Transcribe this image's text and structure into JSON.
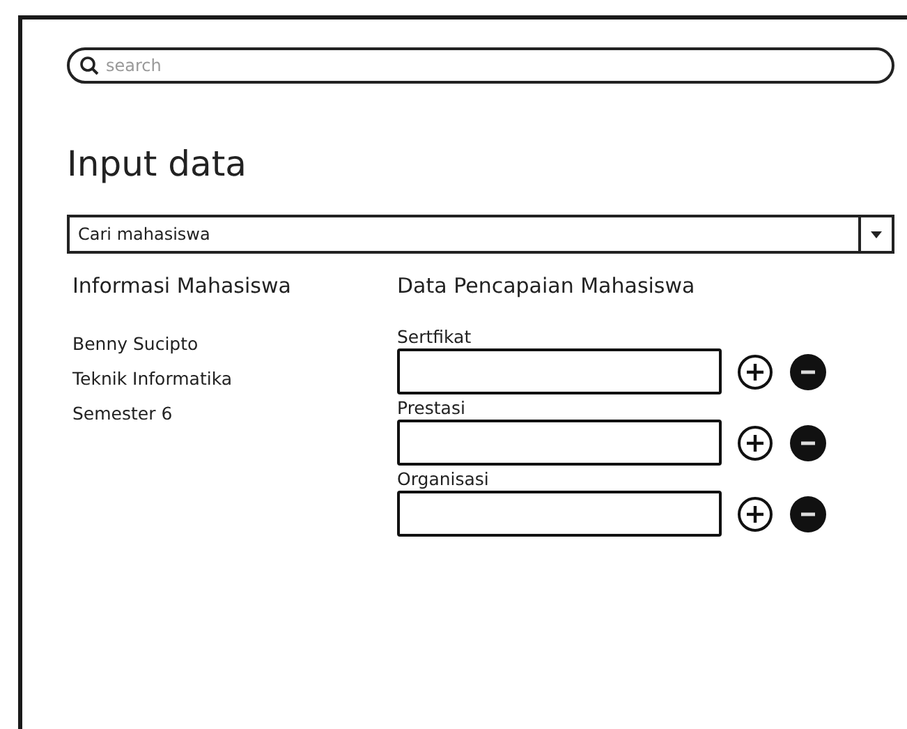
{
  "search": {
    "placeholder": "search"
  },
  "title": "Input data",
  "dropdown": {
    "value": "Cari mahasiswa"
  },
  "student_info": {
    "heading": "Informasi Mahasiswa",
    "lines": [
      "Benny Sucipto",
      "Teknik Informatika",
      "Semester 6"
    ]
  },
  "achievements": {
    "heading": "Data Pencapaian Mahasiswa",
    "fields": [
      {
        "label": "Sertfikat"
      },
      {
        "label": "Prestasi"
      },
      {
        "label": "Organisasi"
      }
    ]
  }
}
